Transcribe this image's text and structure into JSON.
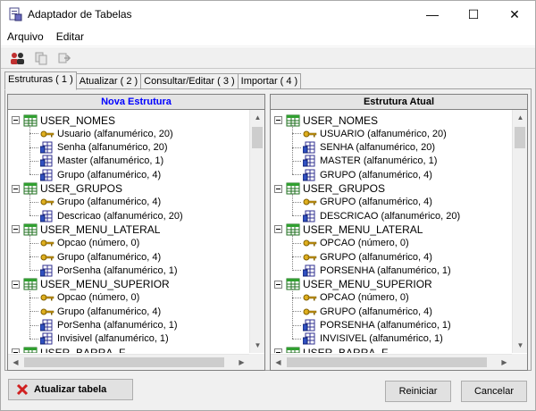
{
  "window": {
    "title": "Adaptador de Tabelas",
    "controls": {
      "minimize": "—",
      "maximize": "☐",
      "close": "✕"
    }
  },
  "menu": {
    "items": [
      "Arquivo",
      "Editar"
    ]
  },
  "toolbar": {
    "icons": [
      "people-icon",
      "copy-icon",
      "export-icon"
    ]
  },
  "tabs": [
    {
      "label": "Estruturas ( 1 )",
      "active": true
    },
    {
      "label": "Atualizar ( 2 )",
      "active": false
    },
    {
      "label": "Consultar/Editar ( 3 )",
      "active": false
    },
    {
      "label": "Importar ( 4 )",
      "active": false
    }
  ],
  "panes": {
    "left": {
      "title": "Nova Estrutura",
      "title_color": "#0000ff",
      "tables": [
        {
          "name": "USER_NOMES",
          "fields": [
            {
              "label": "Usuario (alfanumérico, 20)",
              "icon": "key-icon"
            },
            {
              "label": "Senha (alfanumérico, 20)",
              "icon": "field-icon"
            },
            {
              "label": "Master (alfanumérico, 1)",
              "icon": "field-icon"
            },
            {
              "label": "Grupo (alfanumérico, 4)",
              "icon": "field-icon"
            }
          ]
        },
        {
          "name": "USER_GRUPOS",
          "fields": [
            {
              "label": "Grupo (alfanumérico, 4)",
              "icon": "key-icon"
            },
            {
              "label": "Descricao (alfanumérico, 20)",
              "icon": "field-icon"
            }
          ]
        },
        {
          "name": "USER_MENU_LATERAL",
          "fields": [
            {
              "label": "Opcao (número, 0)",
              "icon": "key-icon"
            },
            {
              "label": "Grupo (alfanumérico, 4)",
              "icon": "key-icon"
            },
            {
              "label": "PorSenha (alfanumérico, 1)",
              "icon": "field-icon"
            }
          ]
        },
        {
          "name": "USER_MENU_SUPERIOR",
          "fields": [
            {
              "label": "Opcao (número, 0)",
              "icon": "key-icon"
            },
            {
              "label": "Grupo (alfanumérico, 4)",
              "icon": "key-icon"
            },
            {
              "label": "PorSenha (alfanumérico, 1)",
              "icon": "field-icon"
            },
            {
              "label": "Invisivel (alfanumérico, 1)",
              "icon": "field-icon"
            }
          ]
        },
        {
          "name": "USER_BARRA_F",
          "fields": []
        }
      ]
    },
    "right": {
      "title": "Estrutura Atual",
      "title_color": "#000000",
      "tables": [
        {
          "name": "USER_NOMES",
          "fields": [
            {
              "label": "USUARIO (alfanumérico, 20)",
              "icon": "key-icon"
            },
            {
              "label": "SENHA (alfanumérico, 20)",
              "icon": "field-icon"
            },
            {
              "label": "MASTER (alfanumérico, 1)",
              "icon": "field-icon"
            },
            {
              "label": "GRUPO (alfanumérico, 4)",
              "icon": "field-icon"
            }
          ]
        },
        {
          "name": "USER_GRUPOS",
          "fields": [
            {
              "label": "GRUPO (alfanumérico, 4)",
              "icon": "key-icon"
            },
            {
              "label": "DESCRICAO (alfanumérico, 20)",
              "icon": "field-icon"
            }
          ]
        },
        {
          "name": "USER_MENU_LATERAL",
          "fields": [
            {
              "label": "OPCAO (número, 0)",
              "icon": "key-icon"
            },
            {
              "label": "GRUPO (alfanumérico, 4)",
              "icon": "key-icon"
            },
            {
              "label": "PORSENHA (alfanumérico, 1)",
              "icon": "field-icon"
            }
          ]
        },
        {
          "name": "USER_MENU_SUPERIOR",
          "fields": [
            {
              "label": "OPCAO (número, 0)",
              "icon": "key-icon"
            },
            {
              "label": "GRUPO (alfanumérico, 4)",
              "icon": "key-icon"
            },
            {
              "label": "PORSENHA (alfanumérico, 1)",
              "icon": "field-icon"
            },
            {
              "label": "INVISIVEL (alfanumérico, 1)",
              "icon": "field-icon"
            }
          ]
        },
        {
          "name": "USER_BARRA_F",
          "fields": []
        }
      ]
    }
  },
  "buttons": {
    "update": {
      "label": "Atualizar tabela",
      "icon": "red-x-icon"
    },
    "reset": "Reiniciar",
    "cancel": "Cancelar"
  }
}
